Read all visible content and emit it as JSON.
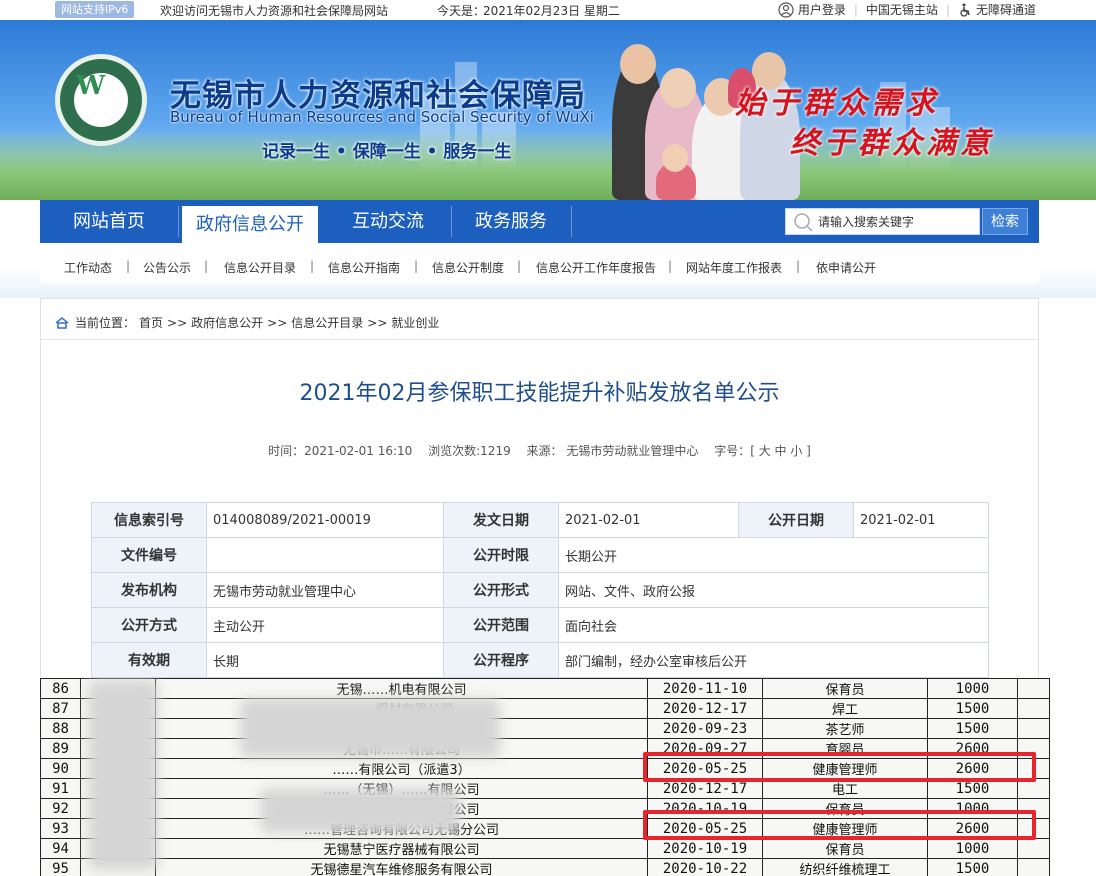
{
  "topbar": {
    "ipv6": "网站支持IPv6",
    "welcome": "欢迎访问无锡市人力资源和社会保障局网站",
    "today_label": "今天是：",
    "today_value": "2021年02月23日 星期二",
    "links": [
      "用户登录",
      "中国无锡主站",
      "无障碍通道"
    ]
  },
  "banner": {
    "org_cn": "无锡市人力资源和社会保障局",
    "org_en": "Bureau of Human Resources and Social Security of WuXi",
    "motto": "记录一生 • 保障一生 • 服务一生",
    "slogan1": "始于群众需求",
    "slogan2": "终于群众满意"
  },
  "nav": {
    "items": [
      "网站首页",
      "政府信息公开",
      "互动交流",
      "政务服务"
    ],
    "active": "政府信息公开",
    "search_placeholder": "请输入搜索关键字",
    "search_button": "检索"
  },
  "subnav": [
    "工作动态",
    "公告公示",
    "信息公开目录",
    "信息公开指南",
    "信息公开制度",
    "信息公开工作年度报告",
    "网站年度工作报表",
    "依申请公开"
  ],
  "breadcrumb": [
    "当前位置：",
    "首页",
    "政府信息公开",
    "信息公开目录",
    "就业创业"
  ],
  "article": {
    "title": "2021年02月参保职工技能提升补贴发放名单公示",
    "time": "时间：2021-02-01 16:10",
    "views": "浏览次数:1219",
    "source": "来源： 无锡市劳动就业管理中心",
    "fontsize": "字号：[ 大 中 小 ]"
  },
  "info_table": {
    "index_no_label": "信息索引号",
    "index_no": "014008089/2021-00019",
    "issue_date_label": "发文日期",
    "issue_date": "2021-02-01",
    "open_date_label": "公开日期",
    "open_date": "2021-02-01",
    "doc_no_label": "文件编号",
    "doc_no": "",
    "open_term_label": "公开时限",
    "open_term": "长期公开",
    "issuer_label": "发布机构",
    "issuer": "无锡市劳动就业管理中心",
    "open_form_label": "公开形式",
    "open_form": "网站、文件、政府公报",
    "open_way_label": "公开方式",
    "open_way": "主动公开",
    "open_scope_label": "公开范围",
    "open_scope": "面向社会",
    "valid_label": "有效期",
    "valid": "长期",
    "procedure_label": "公开程序",
    "procedure": "部门编制，经办公室审核后公开"
  },
  "scan_rows": [
    {
      "no": "86",
      "company": "无锡……机电有限公司",
      "date": "2020-11-10",
      "job": "保育员",
      "amount": "1000"
    },
    {
      "no": "87",
      "company": "……焊材有限公司",
      "date": "2020-12-17",
      "job": "焊工",
      "amount": "1500"
    },
    {
      "no": "88",
      "company": "……有限公司",
      "date": "2020-09-23",
      "job": "茶艺师",
      "amount": "1500"
    },
    {
      "no": "89",
      "company": "无锡市……有限公司",
      "date": "2020-09-27",
      "job": "育婴员",
      "amount": "2600"
    },
    {
      "no": "90",
      "company": "……有限公司（派遣3）",
      "date": "2020-05-25",
      "job": "健康管理师",
      "amount": "2600"
    },
    {
      "no": "91",
      "company": "……（无锡）……有限公司",
      "date": "2020-12-17",
      "job": "电工",
      "amount": "1500"
    },
    {
      "no": "92",
      "company": "……（无锡）……有限公司",
      "date": "2020-10-19",
      "job": "保育员",
      "amount": "1000"
    },
    {
      "no": "93",
      "company": "……管理咨询有限公司无锡分公司",
      "date": "2020-05-25",
      "job": "健康管理师",
      "amount": "2600"
    },
    {
      "no": "94",
      "company": "无锡慧宁医疗器械有限公司",
      "date": "2020-10-19",
      "job": "保育员",
      "amount": "1000"
    },
    {
      "no": "95",
      "company": "无锡德星汽车维修服务有限公司",
      "date": "2020-10-22",
      "job": "纺织纤维梳理工",
      "amount": "1500"
    }
  ],
  "colors": {
    "nav_blue": "#1d5fbf",
    "title_blue": "#1f4e8c",
    "highlight_red": "#e8242c",
    "slogan_red": "#d4141e"
  }
}
